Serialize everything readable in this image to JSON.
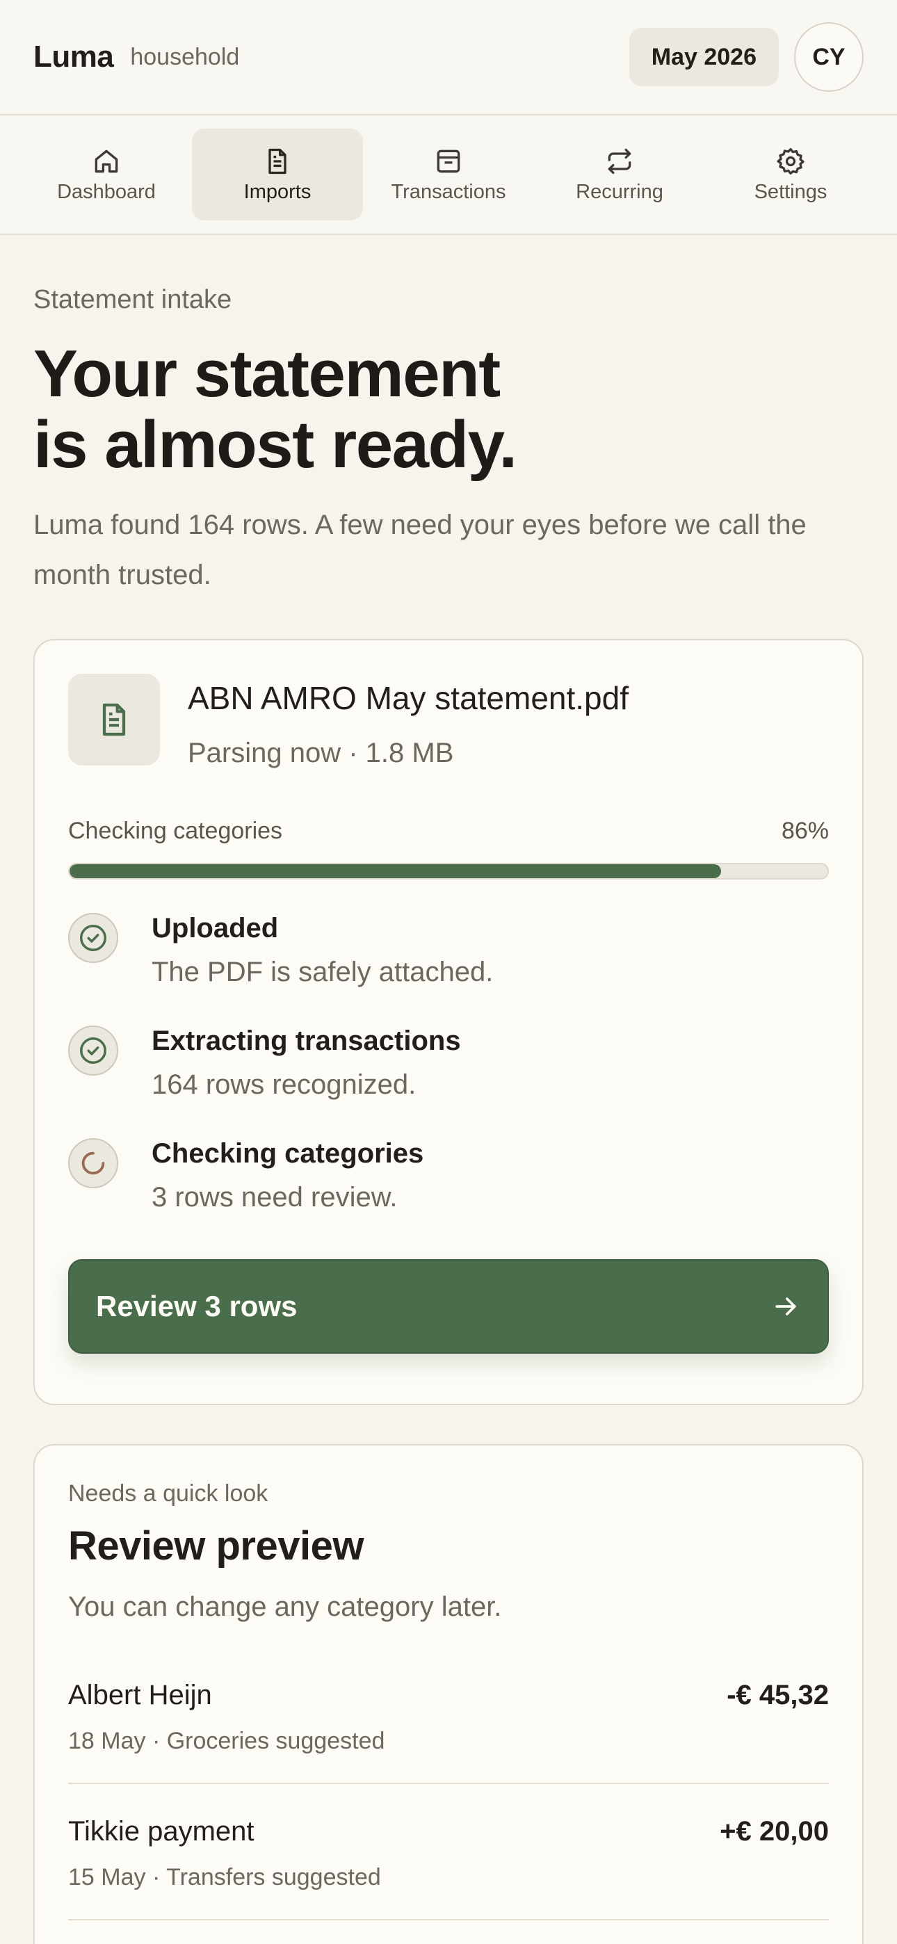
{
  "header": {
    "brand": "Luma",
    "brand_sub": "household",
    "month": "May 2026",
    "avatar_initials": "CY"
  },
  "tabs": [
    {
      "label": "Dashboard",
      "icon": "home-icon"
    },
    {
      "label": "Imports",
      "icon": "document-icon",
      "active": true
    },
    {
      "label": "Transactions",
      "icon": "inbox-icon"
    },
    {
      "label": "Recurring",
      "icon": "repeat-icon"
    },
    {
      "label": "Settings",
      "icon": "gear-icon"
    }
  ],
  "intro": {
    "eyebrow": "Statement intake",
    "title_line1": "Your statement",
    "title_line2": "is almost ready.",
    "lede": "Luma found 164 rows. A few need your eyes before we call the month trusted."
  },
  "file": {
    "name": "ABN AMRO May statement.pdf",
    "status": "Parsing now · 1.8 MB",
    "progress_label": "Checking categories",
    "progress_text": "86%",
    "progress_value": 0.86,
    "steps": [
      {
        "title": "Uploaded",
        "sub": "The PDF is safely attached.",
        "state": "done"
      },
      {
        "title": "Extracting transactions",
        "sub": "164 rows recognized.",
        "state": "done"
      },
      {
        "title": "Checking categories",
        "sub": "3 rows need review.",
        "state": "in-progress"
      }
    ],
    "button_label": "Review 3 rows"
  },
  "review": {
    "eyebrow": "Needs a quick look",
    "title": "Review preview",
    "sub": "You can change any category later.",
    "rows": [
      {
        "name": "Albert Heijn",
        "amount": "-€ 45,32",
        "meta": "18 May · Groceries suggested"
      },
      {
        "name": "Tikkie payment",
        "amount": "+€ 20,00",
        "meta": "15 May · Transfers suggested"
      }
    ]
  },
  "colors": {
    "accent": "#4a6d4b",
    "background": "#f7f4ee",
    "card": "#fdfbf6",
    "spinner": "#9a6a55"
  }
}
